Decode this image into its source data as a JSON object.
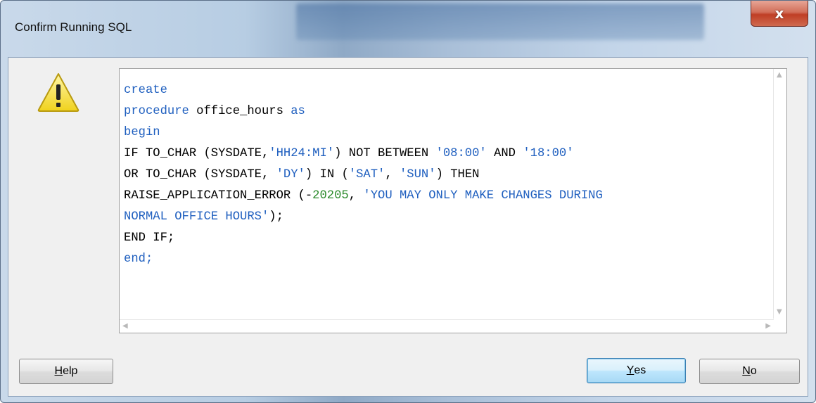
{
  "window": {
    "title": "Confirm Running SQL",
    "close_glyph": "x"
  },
  "dialog": {
    "icon": "warning-icon",
    "sql_lines": [
      [
        {
          "t": "create",
          "c": "kw"
        }
      ],
      [
        {
          "t": "procedure",
          "c": "kw"
        },
        {
          "t": " office_hours ",
          "c": ""
        },
        {
          "t": "as",
          "c": "kw"
        }
      ],
      [
        {
          "t": "begin",
          "c": "kw"
        }
      ],
      [
        {
          "t": "IF TO_CHAR (SYSDATE,",
          "c": ""
        },
        {
          "t": "'HH24:MI'",
          "c": "str"
        },
        {
          "t": ") NOT BETWEEN ",
          "c": ""
        },
        {
          "t": "'08:00'",
          "c": "str"
        },
        {
          "t": " AND ",
          "c": ""
        },
        {
          "t": "'18:00'",
          "c": "str"
        }
      ],
      [
        {
          "t": "OR TO_CHAR (SYSDATE, ",
          "c": ""
        },
        {
          "t": "'DY'",
          "c": "str"
        },
        {
          "t": ") IN (",
          "c": ""
        },
        {
          "t": "'SAT'",
          "c": "str"
        },
        {
          "t": ", ",
          "c": ""
        },
        {
          "t": "'SUN'",
          "c": "str"
        },
        {
          "t": ") THEN",
          "c": ""
        }
      ],
      [
        {
          "t": "RAISE_APPLICATION_ERROR (-",
          "c": ""
        },
        {
          "t": "20205",
          "c": "num"
        },
        {
          "t": ", ",
          "c": ""
        },
        {
          "t": "'YOU MAY ONLY MAKE CHANGES DURING",
          "c": "str"
        }
      ],
      [
        {
          "t": "NORMAL OFFICE HOURS'",
          "c": "str"
        },
        {
          "t": ");",
          "c": ""
        }
      ],
      [
        {
          "t": "END IF;",
          "c": ""
        }
      ],
      [
        {
          "t": "end;",
          "c": "kw"
        }
      ]
    ]
  },
  "buttons": {
    "help": {
      "mnemonic": "H",
      "rest": "elp"
    },
    "yes": {
      "mnemonic": "Y",
      "rest": "es"
    },
    "no": {
      "mnemonic": "N",
      "rest": "o"
    }
  },
  "colors": {
    "keyword": "#1f5fbf",
    "string": "#1f5fbf",
    "number": "#2a8a2a",
    "close_button": "#c4432a",
    "default_button_border": "#3c7fb1"
  }
}
